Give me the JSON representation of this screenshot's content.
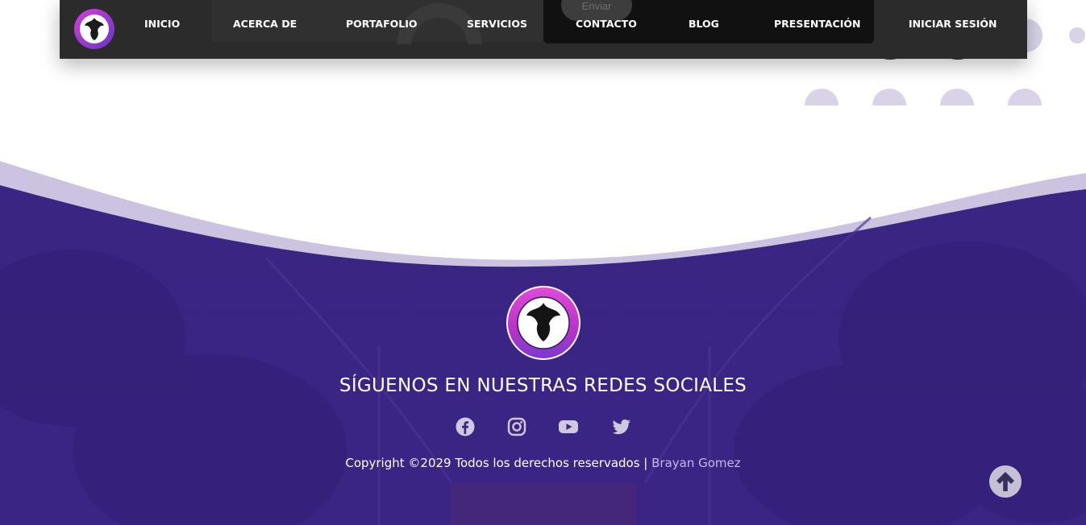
{
  "navbar": {
    "items": [
      {
        "label": "INICIO"
      },
      {
        "label": "ACERCA DE"
      },
      {
        "label": "PORTAFOLIO"
      },
      {
        "label": "SERVICIOS"
      },
      {
        "label": "CONTACTO"
      },
      {
        "label": "BLOG"
      },
      {
        "label": "PRESENTACIÓN"
      },
      {
        "label": "INICIAR SESIÓN"
      }
    ],
    "underlying_button_label": "Enviar"
  },
  "footer": {
    "logo_icon": "phoenix-logo-icon",
    "title": "SÍGUENOS EN NUESTRAS REDES SOCIALES",
    "socials": [
      {
        "icon": "facebook-icon"
      },
      {
        "icon": "instagram-icon"
      },
      {
        "icon": "youtube-icon"
      },
      {
        "icon": "twitter-icon"
      }
    ],
    "copyright_text": "Copyright ©2029 Todos los derechos reservados | ",
    "author": "Brayan Gomez",
    "scroll_top_icon": "arrow-up-icon"
  },
  "colors": {
    "navbar_bg": "#2b2b2b",
    "footer_purple": "#3b2584",
    "wave_lavender": "#cbc3e0",
    "dot_color": "#d9d3e8",
    "author_link": "#c7b9e6",
    "logo_magenta": "#b832c8"
  }
}
